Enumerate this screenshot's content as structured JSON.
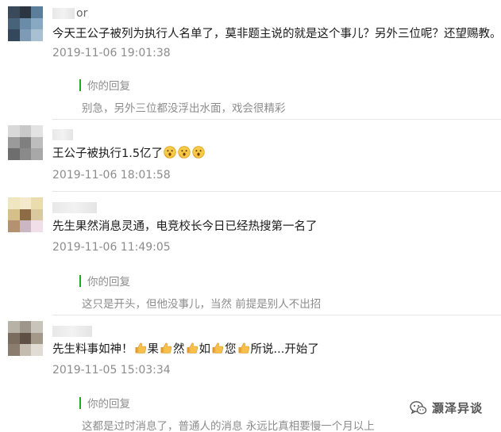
{
  "comments": [
    {
      "nickname_suffix": "or",
      "text": "今天王公子被列为执行人名单了，莫非题主说的就是这个事儿？另外三位呢？还望赐教。",
      "time": "2019-11-06 19:01:38",
      "reply": {
        "label": "你的回复",
        "text": "别急，另外三位都没浮出水面，戏会很精彩"
      }
    },
    {
      "nickname_suffix": "",
      "text": "王公子被执行1.5亿了",
      "emojis": [
        "shocked-face-icon",
        "shocked-face-icon",
        "shocked-face-icon"
      ],
      "time": "2019-11-06 18:01:58"
    },
    {
      "nickname_suffix": "",
      "text": "先生果然消息灵通，电竞校长今日已经热搜第一名了",
      "time": "2019-11-06 11:49:05",
      "reply": {
        "label": "你的回复",
        "text": "这只是开头，但他没事儿，当然 前提是别人不出招"
      }
    },
    {
      "nickname_suffix": "",
      "text_segments": [
        "先生料事如神！",
        "果",
        "然",
        "如",
        "您",
        "所说...开始了"
      ],
      "emojis": [
        "thumbs-up-icon",
        "thumbs-up-icon",
        "thumbs-up-icon",
        "thumbs-up-icon",
        "thumbs-up-icon",
        "thumbs-up-icon"
      ],
      "time": "2019-11-05 15:03:34",
      "reply": {
        "label": "你的回复",
        "text": "这都是过时消息了，普通人的消息 永远比真相要慢一个月以上"
      }
    }
  ],
  "watermark": {
    "text": "灏泽异谈",
    "icon": "wechat-official-account-icon"
  },
  "colors": {
    "reply_bar": "#1aad19",
    "time": "#8c8c8c",
    "divider": "#e6e6e6"
  }
}
